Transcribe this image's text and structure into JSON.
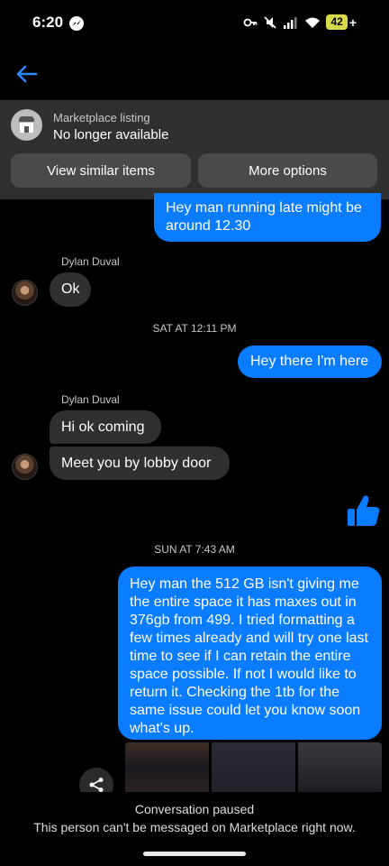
{
  "status": {
    "time": "6:20",
    "battery": "42",
    "battery_suffix": "+"
  },
  "banner": {
    "subtitle": "Marketplace listing",
    "title": "No longer available",
    "view_similar": "View similar items",
    "more_options": "More options"
  },
  "messages": [
    {
      "text": "Hey man running late might be around 12.30",
      "direction": "out"
    },
    {
      "sender": "Dylan Duval",
      "text": "Ok",
      "direction": "in"
    },
    {
      "timestamp": "SAT AT 12:11 PM"
    },
    {
      "text": "Hey there I'm here",
      "direction": "out"
    },
    {
      "sender": "Dylan Duval",
      "text": "Hi ok coming",
      "direction": "in"
    },
    {
      "text": "Meet you by lobby door",
      "direction": "in"
    },
    {
      "reaction": "like-icon",
      "direction": "out"
    },
    {
      "timestamp": "SUN AT 7:43 AM"
    },
    {
      "text": "Hey man the 512 GB isn't giving me the entire space it has maxes out in 376gb from 499. I tried formatting a few times already and will try one last time to see if I can retain the entire space possible. If not I would like to return it. Checking the 1tb for the same issue could let you know soon what's up.",
      "direction": "out"
    }
  ],
  "footer": {
    "title": "Conversation paused",
    "subtitle": "This person can't be messaged on Marketplace right now."
  },
  "colors": {
    "outgoing": "#0a7cff",
    "incoming": "#303030",
    "banner": "#303030",
    "accent": "#0a7cff"
  }
}
